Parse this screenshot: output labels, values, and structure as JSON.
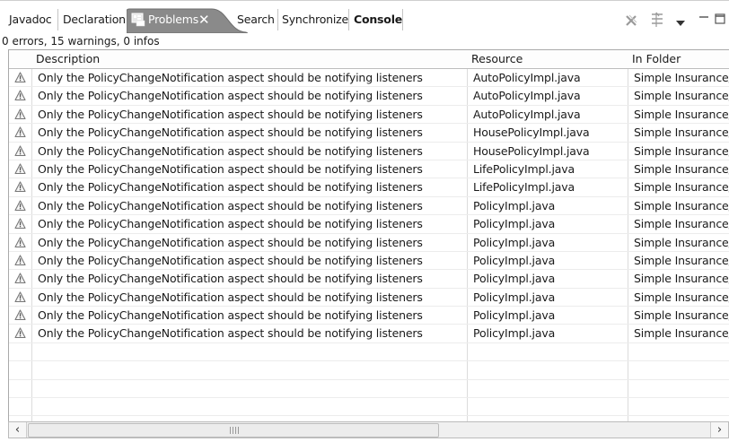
{
  "tabs": [
    {
      "label": "Javadoc"
    },
    {
      "label": "Declaration"
    },
    {
      "label": "Problems",
      "close_glyph": "✕"
    },
    {
      "label": "Search"
    },
    {
      "label": "Synchronize"
    },
    {
      "label": "Console"
    }
  ],
  "toolbar": {
    "remove_icon": "delete-all-icon",
    "filter_icon": "filter-icon",
    "menu_icon": "view-menu-icon",
    "minimize_icon": "minimize-icon",
    "maximize_icon": "maximize-icon"
  },
  "status": "0 errors, 15 warnings, 0 infos",
  "columns": {
    "description": "Description",
    "resource": "Resource",
    "folder": "In Folder"
  },
  "rows": [
    {
      "description": "Only the PolicyChangeNotification aspect should be notifying listeners",
      "resource": "AutoPolicyImpl.java",
      "folder": "Simple Insurance/s"
    },
    {
      "description": "Only the PolicyChangeNotification aspect should be notifying listeners",
      "resource": "AutoPolicyImpl.java",
      "folder": "Simple Insurance/s"
    },
    {
      "description": "Only the PolicyChangeNotification aspect should be notifying listeners",
      "resource": "AutoPolicyImpl.java",
      "folder": "Simple Insurance/s"
    },
    {
      "description": "Only the PolicyChangeNotification aspect should be notifying listeners",
      "resource": "HousePolicyImpl.java",
      "folder": "Simple Insurance/s"
    },
    {
      "description": "Only the PolicyChangeNotification aspect should be notifying listeners",
      "resource": "HousePolicyImpl.java",
      "folder": "Simple Insurance/s"
    },
    {
      "description": "Only the PolicyChangeNotification aspect should be notifying listeners",
      "resource": "LifePolicyImpl.java",
      "folder": "Simple Insurance/s"
    },
    {
      "description": "Only the PolicyChangeNotification aspect should be notifying listeners",
      "resource": "LifePolicyImpl.java",
      "folder": "Simple Insurance/s"
    },
    {
      "description": "Only the PolicyChangeNotification aspect should be notifying listeners",
      "resource": "PolicyImpl.java",
      "folder": "Simple Insurance/s"
    },
    {
      "description": "Only the PolicyChangeNotification aspect should be notifying listeners",
      "resource": "PolicyImpl.java",
      "folder": "Simple Insurance/s"
    },
    {
      "description": "Only the PolicyChangeNotification aspect should be notifying listeners",
      "resource": "PolicyImpl.java",
      "folder": "Simple Insurance/s"
    },
    {
      "description": "Only the PolicyChangeNotification aspect should be notifying listeners",
      "resource": "PolicyImpl.java",
      "folder": "Simple Insurance/s"
    },
    {
      "description": "Only the PolicyChangeNotification aspect should be notifying listeners",
      "resource": "PolicyImpl.java",
      "folder": "Simple Insurance/s"
    },
    {
      "description": "Only the PolicyChangeNotification aspect should be notifying listeners",
      "resource": "PolicyImpl.java",
      "folder": "Simple Insurance/s"
    },
    {
      "description": "Only the PolicyChangeNotification aspect should be notifying listeners",
      "resource": "PolicyImpl.java",
      "folder": "Simple Insurance/s"
    },
    {
      "description": "Only the PolicyChangeNotification aspect should be notifying listeners",
      "resource": "PolicyImpl.java",
      "folder": "Simple Insurance/s"
    }
  ],
  "row_icon": "warning-icon",
  "empty_row_count": 4,
  "scrollbar": {
    "left_icon": "scroll-left-icon",
    "right_icon": "scroll-right-icon"
  }
}
